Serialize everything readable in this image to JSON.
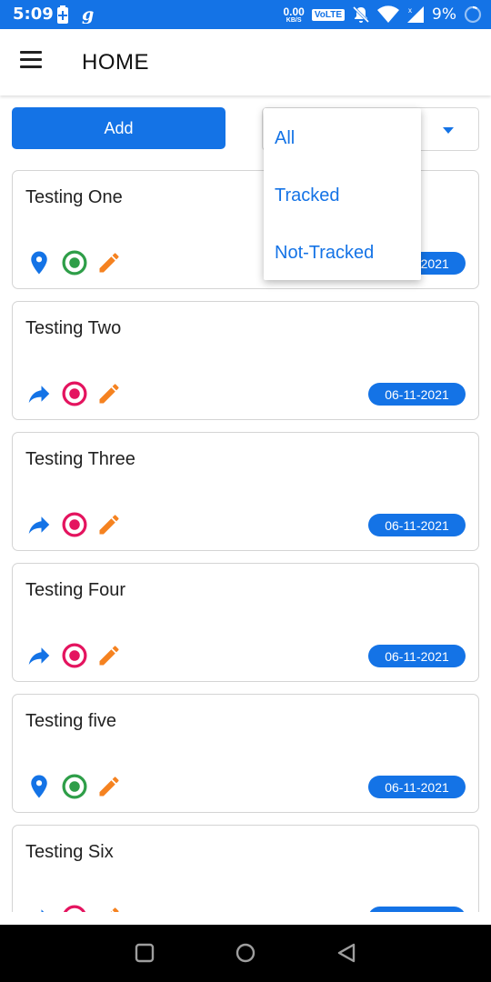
{
  "status_bar": {
    "time": "5:09",
    "net_speed_value": "0.00",
    "net_speed_unit": "KB/S",
    "volte": "VoLTE",
    "battery_pct": "9%"
  },
  "app_bar": {
    "title": "HOME",
    "menu_icon": "hamburger-menu-icon"
  },
  "toolbar": {
    "add_label": "Add"
  },
  "filter": {
    "options": [
      "All",
      "Tracked",
      "Not-Tracked"
    ],
    "expanded": true
  },
  "items": [
    {
      "title": "Testing One",
      "date": "06-11-2021",
      "first_icon": "location-pin-icon",
      "target_state": "tracked"
    },
    {
      "title": "Testing Two",
      "date": "06-11-2021",
      "first_icon": "share-arrow-icon",
      "target_state": "not-tracked"
    },
    {
      "title": "Testing Three",
      "date": "06-11-2021",
      "first_icon": "share-arrow-icon",
      "target_state": "not-tracked"
    },
    {
      "title": "Testing Four",
      "date": "06-11-2021",
      "first_icon": "share-arrow-icon",
      "target_state": "not-tracked"
    },
    {
      "title": "Testing five",
      "date": "06-11-2021",
      "first_icon": "location-pin-icon",
      "target_state": "tracked"
    },
    {
      "title": "Testing Six",
      "date": "",
      "first_icon": "share-arrow-icon",
      "target_state": "not-tracked"
    }
  ],
  "colors": {
    "primary": "#1473e6",
    "tracked_green": "#2e9e48",
    "not_tracked_pink": "#e4145f",
    "edit_orange": "#f58220"
  }
}
